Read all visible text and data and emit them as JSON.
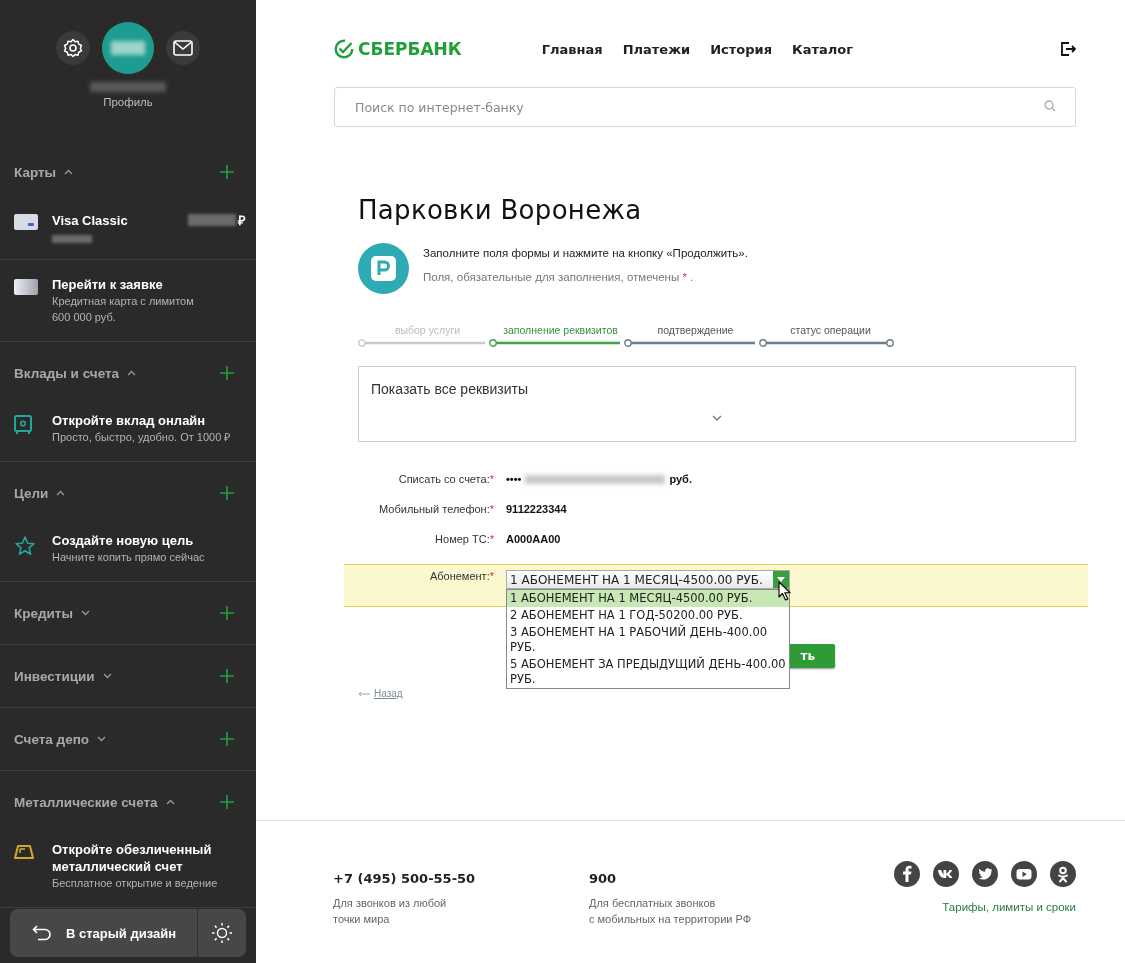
{
  "sidebar": {
    "profile_label": "Профиль",
    "sections": [
      {
        "title": "Карты",
        "expanded": true,
        "items": [
          {
            "kind": "account-card",
            "title": "Visa Classic",
            "currency": "₽"
          },
          {
            "kind": "application-card",
            "title": "Перейти к заявке",
            "subtitle": "Кредитная карта с лимитом\n600 000 руб."
          }
        ]
      },
      {
        "title": "Вклады и счета",
        "expanded": true,
        "items": [
          {
            "kind": "deposit",
            "title": "Откройте вклад онлайн",
            "subtitle": "Просто, быстро, удобно. От 1000 ₽"
          }
        ]
      },
      {
        "title": "Цели",
        "expanded": true,
        "items": [
          {
            "kind": "goal",
            "title": "Создайте новую цель",
            "subtitle": "Начните копить прямо сейчас"
          }
        ]
      },
      {
        "title": "Кредиты",
        "expanded": false
      },
      {
        "title": "Инвестиции",
        "expanded": false
      },
      {
        "title": "Счета депо",
        "expanded": false
      },
      {
        "title": "Металлические счета",
        "expanded": true,
        "items": [
          {
            "kind": "metal",
            "title": "Откройте обезличенный металлический счет",
            "subtitle": "Бесплатное открытие и ведение"
          }
        ]
      }
    ],
    "old_design_button": "В старый дизайн"
  },
  "header": {
    "logo": "СБЕРБАНК",
    "nav": [
      "Главная",
      "Платежи",
      "История",
      "Каталог"
    ]
  },
  "search": {
    "placeholder": "Поиск по интернет-банку"
  },
  "page": {
    "title": "Парковки Воронежа",
    "intro": "Заполните поля формы и нажмите на кнопку «Продолжить».",
    "required_note": "Поля, обязательные для заполнения, отмечены",
    "required_mark": "*",
    "required_end": ".",
    "steps": [
      {
        "label": "выбор услуги",
        "completed": true,
        "selected": false
      },
      {
        "label": "заполнение реквизитов",
        "completed": false,
        "selected": true
      },
      {
        "label": "подтверждение",
        "completed": false,
        "selected": false
      },
      {
        "label": "статус операции",
        "completed": false,
        "selected": false
      }
    ],
    "details_toggle": "Показать все реквизиты",
    "fields": [
      {
        "kind": "masked",
        "label": "Списать со счета:",
        "required_mark": "*",
        "value": "••••",
        "suffix": "руб."
      },
      {
        "kind": "text",
        "label": "Мобильный телефон:",
        "required_mark": "*",
        "value": "9112223344"
      },
      {
        "kind": "text",
        "label": "Номер ТС:",
        "required_mark": "*",
        "value": "A000AA00"
      },
      {
        "kind": "select",
        "label": "Абонемент:",
        "required_mark": "*",
        "value": "1 АБОНЕМЕНТ НА 1 МЕСЯЦ-4500.00 РУБ.",
        "highlighted": true,
        "expanded": true,
        "options": [
          {
            "label": "1 АБОНЕМЕНТ НА 1 МЕСЯЦ-4500.00 РУБ.",
            "selected": true
          },
          {
            "label": "2 АБОНЕМЕНТ НА 1 ГОД-50200.00 РУБ.",
            "selected": false
          },
          {
            "label": "3 АБОНЕМЕНТ НА 1 РАБОЧИЙ ДЕНЬ-400.00 РУБ.",
            "selected": false
          },
          {
            "label": "5 АБОНЕМЕНТ ЗА ПРЕДЫДУЩИЙ ДЕНЬ-400.00 РУБ.",
            "selected": false
          }
        ]
      }
    ],
    "continue_button": "ть",
    "back_link": "Назад"
  },
  "footer": {
    "contacts": [
      {
        "phone": "+7 (495) 500-55-50",
        "note": "Для звонков из любой\nточки мира"
      },
      {
        "phone": "900",
        "note": "Для бесплатных звонков\nс мобильных на территории РФ"
      }
    ],
    "tariffs_link": "Тарифы, лимиты и сроки"
  }
}
